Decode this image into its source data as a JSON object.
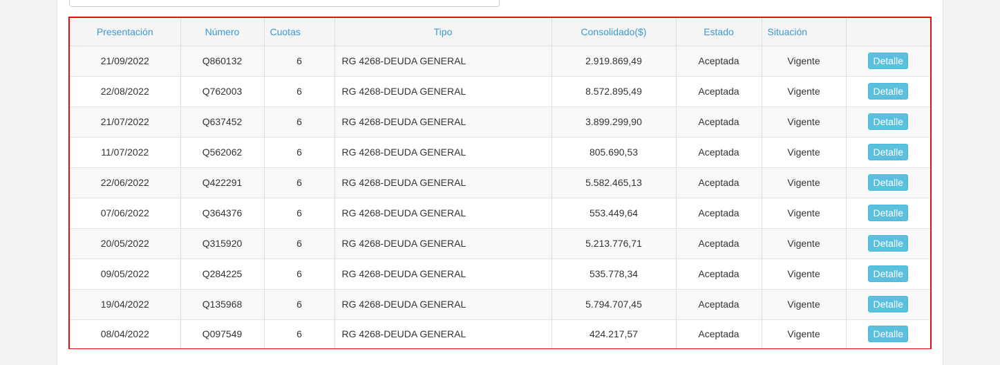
{
  "table": {
    "headers": {
      "presentacion": "Presentación",
      "numero": "Número",
      "cuotas": "Cuotas",
      "tipo": "Tipo",
      "consolidado": "Consolidado($)",
      "estado": "Estado",
      "situacion": "Situación",
      "acciones": ""
    },
    "rows": [
      {
        "presentacion": "21/09/2022",
        "numero": "Q860132",
        "cuotas": "6",
        "tipo": "RG 4268-DEUDA GENERAL",
        "consolidado": "2.919.869,49",
        "estado": "Aceptada",
        "situacion": "Vigente",
        "accion": "Detalle"
      },
      {
        "presentacion": "22/08/2022",
        "numero": "Q762003",
        "cuotas": "6",
        "tipo": "RG 4268-DEUDA GENERAL",
        "consolidado": "8.572.895,49",
        "estado": "Aceptada",
        "situacion": "Vigente",
        "accion": "Detalle"
      },
      {
        "presentacion": "21/07/2022",
        "numero": "Q637452",
        "cuotas": "6",
        "tipo": "RG 4268-DEUDA GENERAL",
        "consolidado": "3.899.299,90",
        "estado": "Aceptada",
        "situacion": "Vigente",
        "accion": "Detalle"
      },
      {
        "presentacion": "11/07/2022",
        "numero": "Q562062",
        "cuotas": "6",
        "tipo": "RG 4268-DEUDA GENERAL",
        "consolidado": "805.690,53",
        "estado": "Aceptada",
        "situacion": "Vigente",
        "accion": "Detalle"
      },
      {
        "presentacion": "22/06/2022",
        "numero": "Q422291",
        "cuotas": "6",
        "tipo": "RG 4268-DEUDA GENERAL",
        "consolidado": "5.582.465,13",
        "estado": "Aceptada",
        "situacion": "Vigente",
        "accion": "Detalle"
      },
      {
        "presentacion": "07/06/2022",
        "numero": "Q364376",
        "cuotas": "6",
        "tipo": "RG 4268-DEUDA GENERAL",
        "consolidado": "553.449,64",
        "estado": "Aceptada",
        "situacion": "Vigente",
        "accion": "Detalle"
      },
      {
        "presentacion": "20/05/2022",
        "numero": "Q315920",
        "cuotas": "6",
        "tipo": "RG 4268-DEUDA GENERAL",
        "consolidado": "5.213.776,71",
        "estado": "Aceptada",
        "situacion": "Vigente",
        "accion": "Detalle"
      },
      {
        "presentacion": "09/05/2022",
        "numero": "Q284225",
        "cuotas": "6",
        "tipo": "RG 4268-DEUDA GENERAL",
        "consolidado": "535.778,34",
        "estado": "Aceptada",
        "situacion": "Vigente",
        "accion": "Detalle"
      },
      {
        "presentacion": "19/04/2022",
        "numero": "Q135968",
        "cuotas": "6",
        "tipo": "RG 4268-DEUDA GENERAL",
        "consolidado": "5.794.707,45",
        "estado": "Aceptada",
        "situacion": "Vigente",
        "accion": "Detalle"
      },
      {
        "presentacion": "08/04/2022",
        "numero": "Q097549",
        "cuotas": "6",
        "tipo": "RG 4268-DEUDA GENERAL",
        "consolidado": "424.217,57",
        "estado": "Aceptada",
        "situacion": "Vigente",
        "accion": "Detalle"
      }
    ]
  },
  "colors": {
    "header_text": "#3a9ad1",
    "button_bg": "#5bc0de",
    "highlight_border": "#e01010"
  }
}
